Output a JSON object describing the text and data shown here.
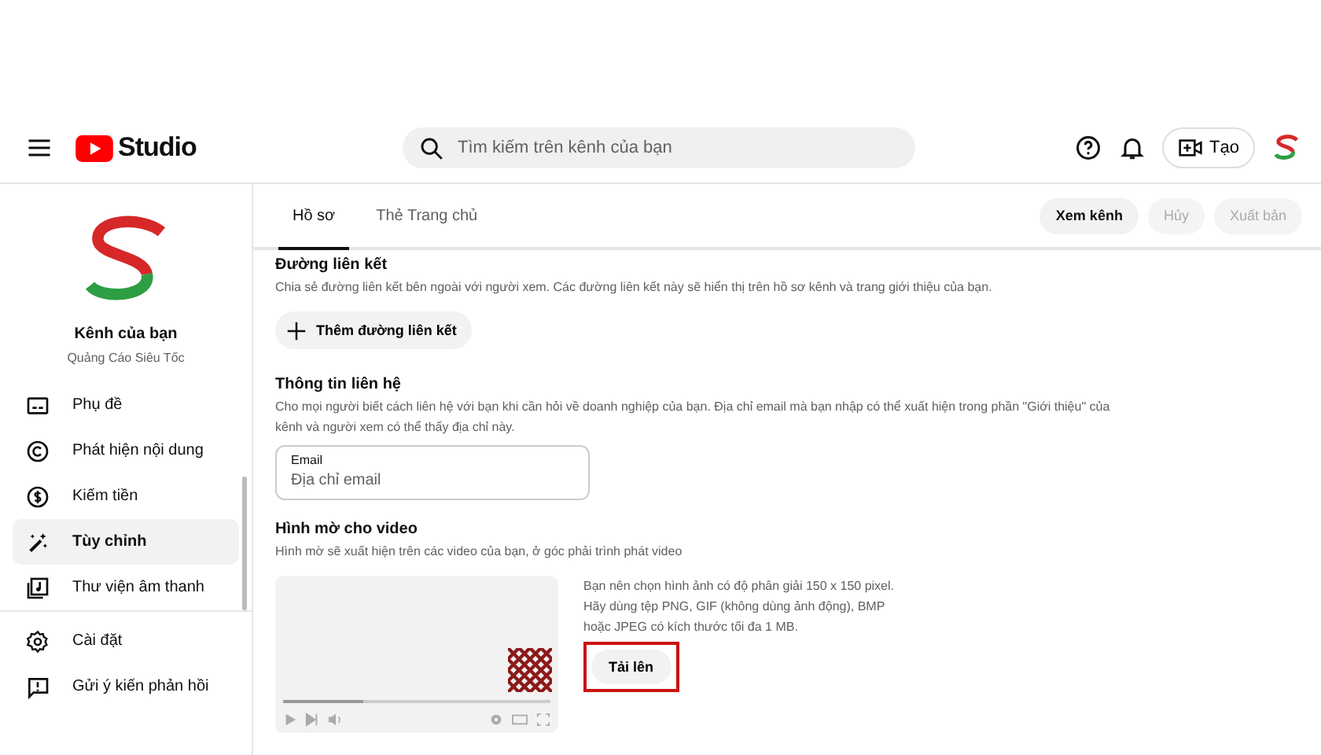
{
  "header": {
    "logo_text": "Studio",
    "search": {
      "placeholder": "Tìm kiếm trên kênh của bạn"
    },
    "create_button": "Tạo"
  },
  "channel": {
    "title": "Kênh của bạn",
    "name": "Quảng Cáo Siêu Tốc"
  },
  "sidebar": {
    "items": [
      {
        "label": "Phụ đề",
        "selected": false
      },
      {
        "label": "Phát hiện nội dung",
        "selected": false
      },
      {
        "label": "Kiếm tiền",
        "selected": false
      },
      {
        "label": "Tùy chỉnh",
        "selected": true
      },
      {
        "label": "Thư viện âm thanh",
        "selected": false
      }
    ],
    "footer_items": [
      {
        "label": "Cài đặt",
        "selected": false
      },
      {
        "label": "Gửi ý kiến phản hồi",
        "selected": false
      }
    ]
  },
  "tabs": [
    {
      "label": "Hồ sơ",
      "selected": true
    },
    {
      "label": "Thẻ Trang chủ",
      "selected": false
    }
  ],
  "actions": [
    {
      "label": "Xem kênh",
      "disabled": false
    },
    {
      "label": "Hủy",
      "disabled": true
    },
    {
      "label": "Xuất bản",
      "disabled": true
    }
  ],
  "links_section": {
    "title": "Đường liên kết",
    "description": "Chia sẻ đường liên kết bên ngoài với người xem. Các đường liên kết này sẽ hiển thị trên hồ sơ kênh và trang giới thiệu của bạn.",
    "add_button": "Thêm đường liên kết"
  },
  "contact_section": {
    "title": "Thông tin liên hệ",
    "description": "Cho mọi người biết cách liên hệ với bạn khi cần hỏi về doanh nghiệp của bạn. Địa chỉ email mà bạn nhập có thể xuất hiện trong phần \"Giới thiệu\" của kênh và người xem có thể thấy địa chỉ này.",
    "email_label": "Email",
    "email_placeholder": "Địa chỉ email"
  },
  "watermark_section": {
    "title": "Hình mờ cho video",
    "description": "Hình mờ sẽ xuất hiện trên các video của bạn, ở góc phải trình phát video",
    "player": {
      "level": 0.3
    },
    "hint_lines": [
      "Bạn nên chọn hình ảnh có độ phân giải 150 x 150 pixel.",
      "Hãy dùng tệp PNG, GIF (không dùng ảnh động), BMP",
      "hoặc JPEG có kích thước tối đa 1 MB."
    ],
    "upload_button": {
      "label": "Tải lên",
      "highlighted": true
    }
  }
}
